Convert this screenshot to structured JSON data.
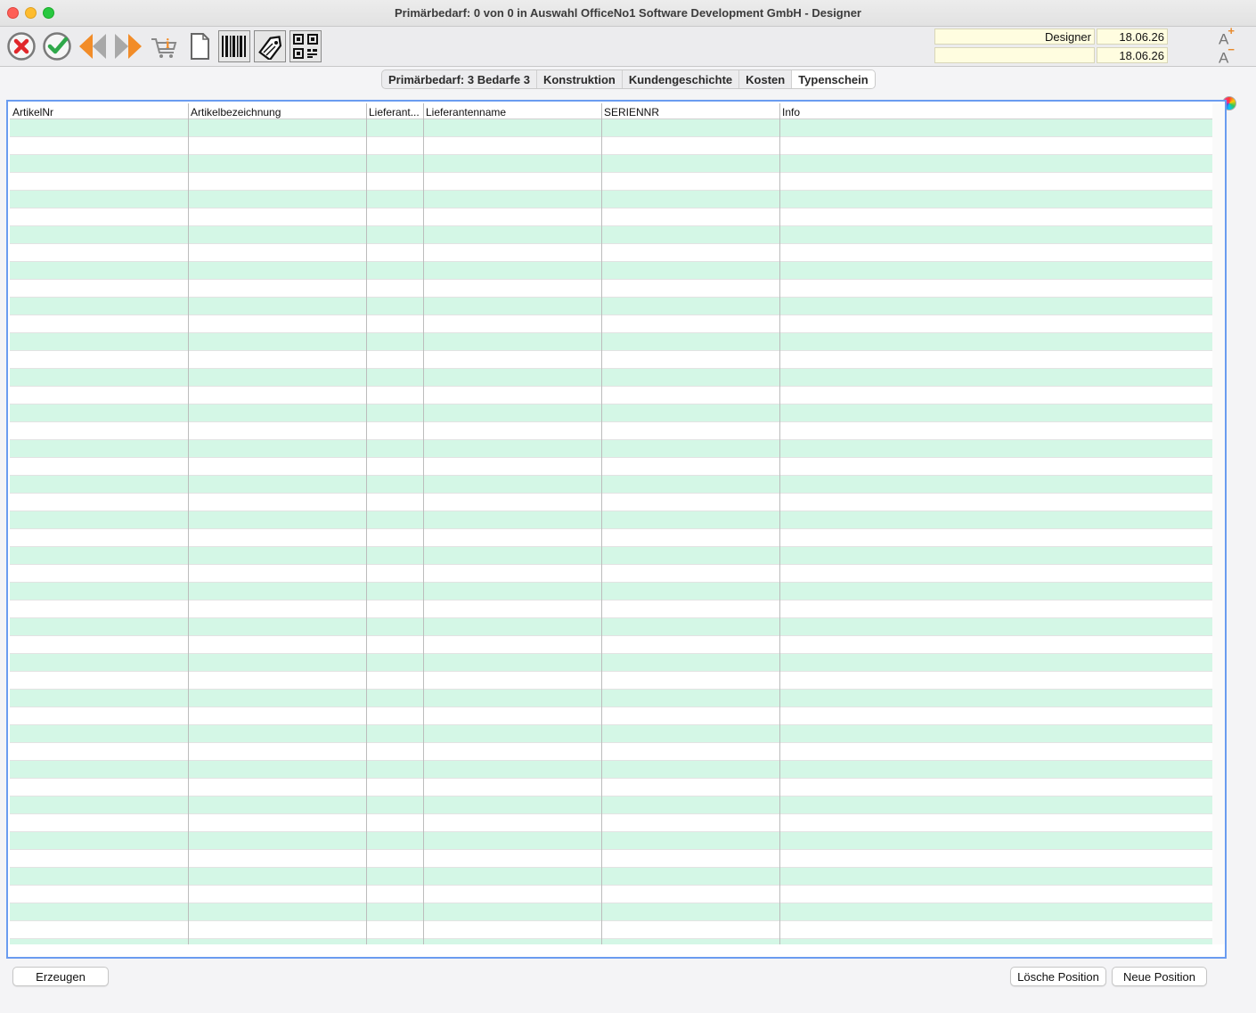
{
  "window": {
    "title": "Primärbedarf: 0 von 0 in Auswahl OfficeNo1 Software Development GmbH - Designer"
  },
  "toolbar": {
    "buttons": [
      {
        "name": "cancel",
        "icon": "cancel-x-icon"
      },
      {
        "name": "confirm",
        "icon": "checkmark-icon"
      },
      {
        "name": "previous",
        "icon": "arrow-left-icon"
      },
      {
        "name": "next",
        "icon": "arrow-right-icon"
      },
      {
        "name": "cart-info",
        "icon": "cart-info-icon"
      },
      {
        "name": "new-document",
        "icon": "document-icon"
      },
      {
        "name": "barcode",
        "icon": "barcode-icon"
      },
      {
        "name": "price-tag",
        "icon": "price-tag-icon"
      },
      {
        "name": "qr-code",
        "icon": "qr-code-icon"
      }
    ],
    "user_field": "Designer",
    "date1": "18.06.26",
    "secondary_field": "",
    "date2": "18.06.26",
    "font_increase": "A",
    "font_decrease": "A"
  },
  "tabs": [
    {
      "label": "Primärbedarf: 3 Bedarfe 3",
      "active": false
    },
    {
      "label": "Konstruktion",
      "active": false
    },
    {
      "label": "Kundengeschichte",
      "active": false
    },
    {
      "label": "Kosten",
      "active": false
    },
    {
      "label": "Typenschein",
      "active": true
    }
  ],
  "table": {
    "columns": [
      "ArtikelNr",
      "Artikelbezeichnung",
      "Lieferant...",
      "Lieferantenname",
      "SERIENNR",
      "Info"
    ],
    "row_count": 0,
    "colors": {
      "stripe": "#d4f7e6",
      "border_focus": "#6a9cf0"
    }
  },
  "footer": {
    "create_label": "Erzeugen",
    "delete_label": "Lösche Position",
    "new_label": "Neue Position"
  }
}
